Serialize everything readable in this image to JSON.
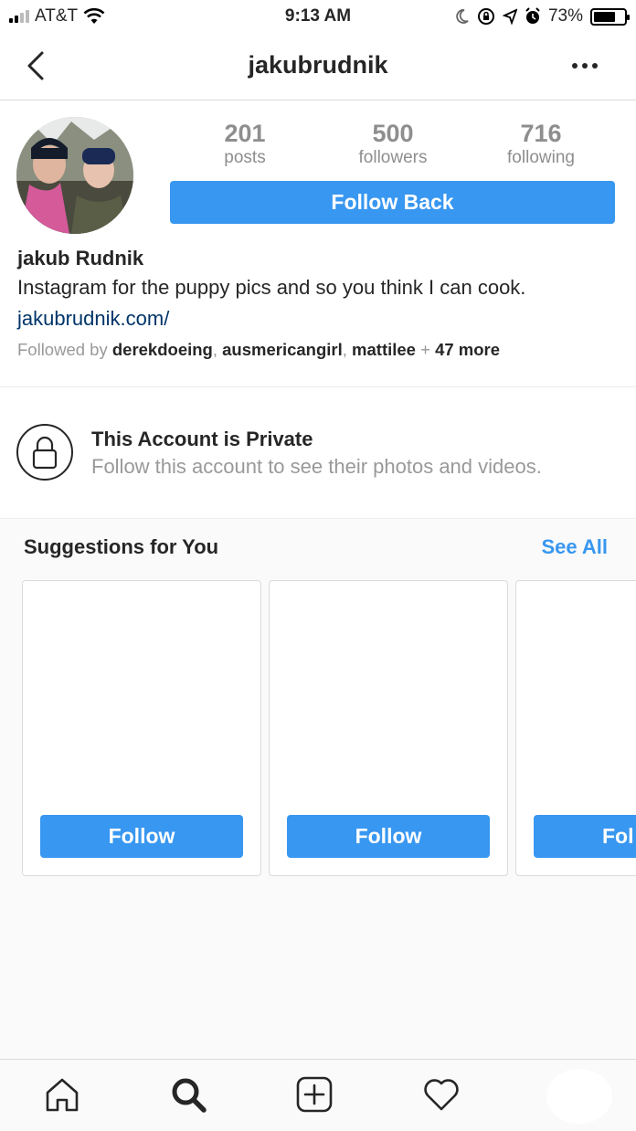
{
  "status_bar": {
    "carrier": "AT&T",
    "time": "9:13 AM",
    "battery": "73%",
    "battery_level": 0.73
  },
  "nav": {
    "title": "jakubrudnik",
    "back_icon": "chevron-left-icon",
    "more_icon": "more-horizontal-icon"
  },
  "profile": {
    "stats": [
      {
        "value": "201",
        "label": "posts"
      },
      {
        "value": "500",
        "label": "followers"
      },
      {
        "value": "716",
        "label": "following"
      }
    ],
    "follow_back_label": "Follow Back",
    "full_name": "jakub Rudnik",
    "bio": "Instagram for the puppy pics and so you think I can cook.",
    "website": "jakubrudnik.com/",
    "followed_by_prefix": "Followed by ",
    "followed_by_users": [
      "derekdoeing",
      "ausmericangirl",
      "mattilee"
    ],
    "followed_by_more": "47 more"
  },
  "private": {
    "title": "This Account is Private",
    "subtitle": "Follow this account to see their photos and videos."
  },
  "suggestions": {
    "title": "Suggestions for You",
    "see_all": "See All",
    "cards": [
      {
        "button": "Follow"
      },
      {
        "button": "Follow"
      },
      {
        "button": "Fol"
      }
    ]
  },
  "tab_bar": {
    "items": [
      "home-icon",
      "search-icon",
      "new-post-icon",
      "activity-icon",
      "profile-icon"
    ]
  },
  "colors": {
    "accent": "#3897f0",
    "link": "#003569",
    "text": "#262626",
    "muted": "#999999"
  }
}
